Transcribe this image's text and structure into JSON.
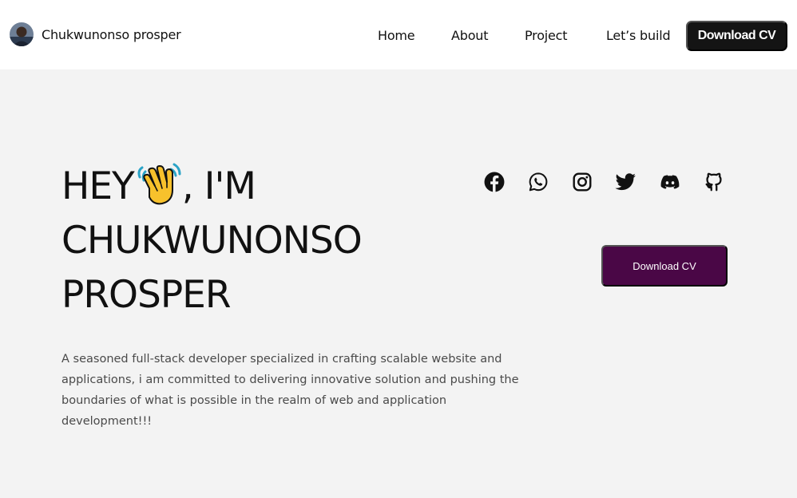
{
  "header": {
    "brand_name": "Chukwunonso prosper",
    "avatar_icon": "profile-photo",
    "nav": [
      {
        "label": "Home"
      },
      {
        "label": "About"
      },
      {
        "label": "Project"
      },
      {
        "label": "Let’s build"
      }
    ],
    "cta_label": "Download CV",
    "cta_color": "#141414"
  },
  "hero": {
    "title_line1_start": "HEY",
    "title_emoji": "waving-hand-icon",
    "title_line1_end": ", I'M",
    "title_line2": "CHUKWUNONSO",
    "title_line3": "PROSPER",
    "description": "A seasoned full-stack developer specialized in crafting scalable website and applications, i am committed to delivering innovative solution and pushing the boundaries of what is possible in the realm of web and application development!!!",
    "cta_label": "Download CV",
    "cta_color": "#4a0746"
  },
  "socials": [
    {
      "icon": "facebook-icon"
    },
    {
      "icon": "whatsapp-icon"
    },
    {
      "icon": "instagram-icon"
    },
    {
      "icon": "twitter-icon"
    },
    {
      "icon": "discord-icon"
    },
    {
      "icon": "github-icon"
    }
  ],
  "colors": {
    "background": "#f3f3f3",
    "header_background": "#ffffff",
    "text": "#111111"
  }
}
